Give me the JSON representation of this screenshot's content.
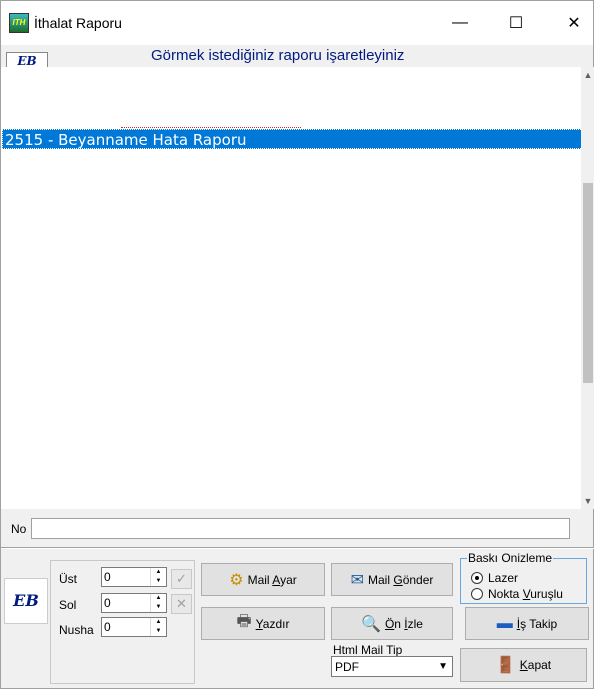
{
  "window": {
    "title": "İthalat Raporu",
    "icon_text": "ITH",
    "minimize_glyph": "—",
    "maximize_glyph": "☐",
    "close_glyph": "✕"
  },
  "header": {
    "logo_text": "EB",
    "instruction": "Görmek istediğiniz raporu işaretleyiniz"
  },
  "report_list": {
    "items": [
      {
        "label": "2515 - Beyanname Hata Raporu",
        "selected": true
      }
    ]
  },
  "no_field": {
    "label": "No",
    "value": ""
  },
  "bottom_logo": "EB",
  "margins": {
    "ust_label": "Üst",
    "ust_value": "0",
    "sol_label": "Sol",
    "sol_value": "0",
    "nusha_label": "Nusha",
    "nusha_value": "0"
  },
  "buttons": {
    "mail_ayar_prefix": "Mail ",
    "mail_ayar_ul": "A",
    "mail_ayar_suffix": "yar",
    "mail_gonder_prefix": "Mail ",
    "mail_gonder_ul": "G",
    "mail_gonder_suffix": "önder",
    "yazdir_ul": "Y",
    "yazdir_suffix": "azdır",
    "on_izle_ul1": "Ö",
    "on_izle_mid": "n ",
    "on_izle_ul2": "İ",
    "on_izle_suffix": "zle",
    "is_takip_ul": "İ",
    "is_takip_suffix": "ş Takip",
    "kapat_ul": "K",
    "kapat_suffix": "apat"
  },
  "print_mode": {
    "legend": "Baskı Onizleme",
    "lazer": "Lazer",
    "nokta_prefix": "Nokta ",
    "nokta_ul": "V",
    "nokta_suffix": "uruşlu",
    "selected": "Lazer"
  },
  "html_mail": {
    "label": "Html Mail Tip",
    "value": "PDF"
  },
  "colors": {
    "selection": "#0078d7",
    "header_text": "#001a80",
    "window_bg": "#f0f0f0"
  }
}
